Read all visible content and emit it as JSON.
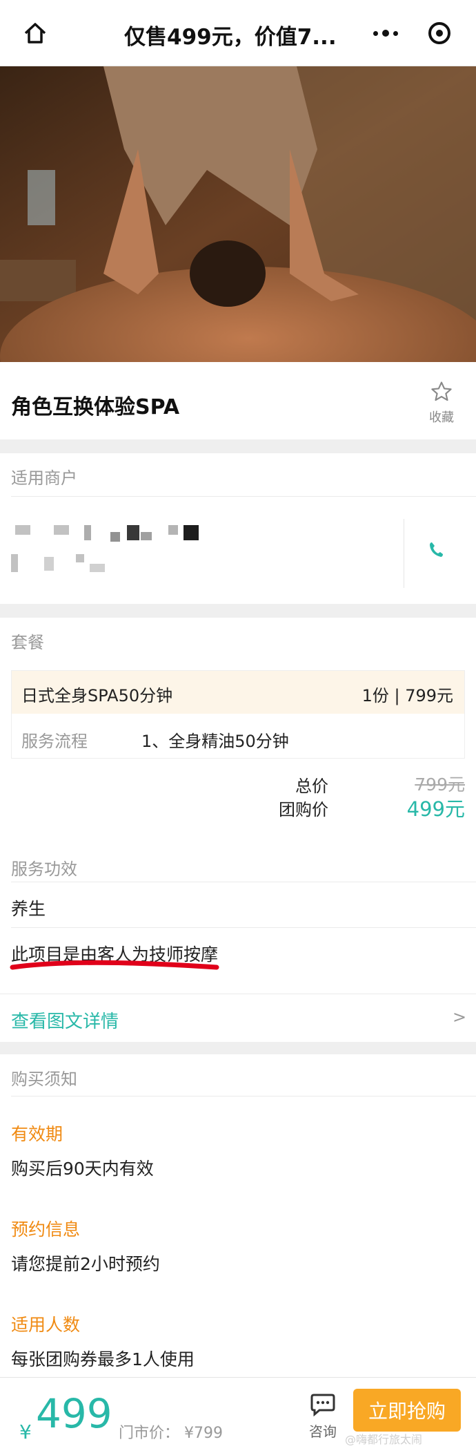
{
  "navbar": {
    "title": "仅售499元，价值7...",
    "home_icon": "home-icon",
    "more_icon": "more-icon",
    "close_icon": "target-icon"
  },
  "hero": {
    "image_desc": "massage-photo"
  },
  "product": {
    "title": "角色互换体验SPA",
    "favorite_label": "收藏"
  },
  "merchant": {
    "section_title": "适用商户",
    "phone_icon": "phone-icon"
  },
  "package": {
    "section_title": "套餐",
    "item_name": "日式全身SPA50分钟",
    "item_qty_price": "1份 | 799元",
    "process_label": "服务流程",
    "process_value": "1、全身精油50分钟",
    "total_label": "总价",
    "total_value": "799元",
    "group_label": "团购价",
    "group_value": "499元",
    "effect_title": "服务功效",
    "effect_1": "养生",
    "effect_2": "此项目是由客人为技师按摩",
    "detail_link": "查看图文详情",
    "detail_arrow": ">"
  },
  "notice": {
    "section_title": "购买须知",
    "validity_title": "有效期",
    "validity_text": "购买后90天内有效",
    "booking_title": "预约信息",
    "booking_text": "请您提前2小时预约",
    "people_title": "适用人数",
    "people_text": "每张团购券最多1人使用"
  },
  "bottom": {
    "currency": "¥",
    "price": "499",
    "market_price": "门市价：  ¥799",
    "consult_label": "咨询",
    "buy_label": "立即抢购",
    "watermark": "@嗨都行旅太闹"
  },
  "colors": {
    "accent": "#28b8a8",
    "orange": "#f08a12",
    "button": "#f9a825"
  }
}
